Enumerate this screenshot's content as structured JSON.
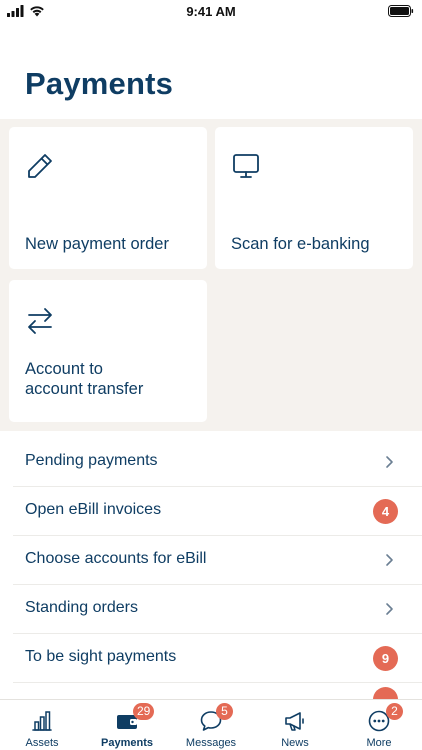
{
  "status_bar": {
    "time": "9:41 AM"
  },
  "header": {
    "title": "Payments"
  },
  "tiles": [
    {
      "label": "New payment order",
      "icon": "pencil-icon"
    },
    {
      "label": "Scan for e-banking",
      "icon": "monitor-icon"
    },
    {
      "label_line1": "Account to",
      "label_line2": "account transfer",
      "icon": "transfer-arrows-icon"
    }
  ],
  "menu": [
    {
      "label": "Pending payments",
      "type": "chevron"
    },
    {
      "label": "Open eBill invoices",
      "type": "badge",
      "badge": "4"
    },
    {
      "label": "Choose accounts for eBill",
      "type": "chevron"
    },
    {
      "label": "Standing orders",
      "type": "chevron"
    },
    {
      "label": "To be sight payments",
      "type": "badge",
      "badge": "9"
    }
  ],
  "tab_bar": {
    "assets": {
      "label": "Assets",
      "icon": "bar-chart-icon"
    },
    "payments": {
      "label": "Payments",
      "badge": "29",
      "icon": "wallet-icon",
      "active": true
    },
    "messages": {
      "label": "Messages",
      "badge": "5",
      "icon": "chat-bubble-icon"
    },
    "news": {
      "label": "News",
      "icon": "megaphone-icon"
    },
    "more": {
      "label": "More",
      "badge": "2",
      "icon": "more-dots-icon"
    }
  },
  "colors": {
    "primary": "#0f3d63",
    "badge": "#e46a55",
    "tile_background": "#f5f2ee"
  }
}
